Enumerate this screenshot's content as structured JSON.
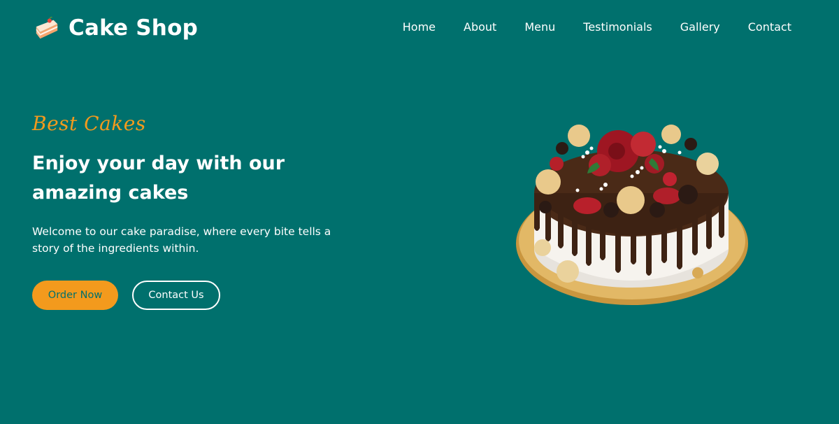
{
  "brand": {
    "name": "Cake Shop",
    "icon": "cake-slice-icon"
  },
  "nav": {
    "items": [
      "Home",
      "About",
      "Menu",
      "Testimonials",
      "Gallery",
      "Contact"
    ]
  },
  "hero": {
    "subtitle": "Best Cakes",
    "title": "Enjoy your day with our amazing cakes",
    "description": "Welcome to our cake paradise, where every bite tells a story of the ingredients within.",
    "primary_button": "Order Now",
    "secondary_button": "Contact Us",
    "image": "decorated-chocolate-drip-cake"
  },
  "colors": {
    "background": "#00706d",
    "accent": "#f39a1d",
    "text": "#ffffff"
  }
}
